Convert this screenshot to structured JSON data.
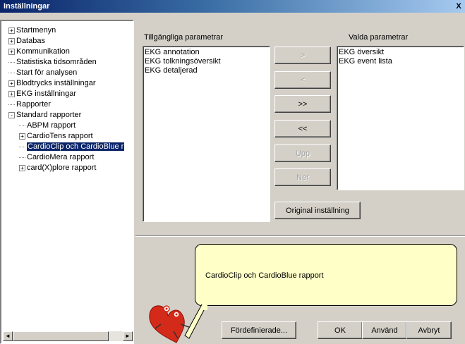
{
  "window": {
    "title": "Inställningar",
    "close_glyph": "X"
  },
  "tree": {
    "items": [
      {
        "label": "Startmenyn",
        "expander": "+"
      },
      {
        "label": "Databas",
        "expander": "+"
      },
      {
        "label": "Kommunikation",
        "expander": "+"
      },
      {
        "label": "Statistiska tidsområden",
        "expander": ""
      },
      {
        "label": "Start för analysen",
        "expander": ""
      },
      {
        "label": "Blodtrycks inställningar",
        "expander": "+"
      },
      {
        "label": "EKG inställningar",
        "expander": "+"
      },
      {
        "label": "Rapporter",
        "expander": ""
      },
      {
        "label": "Standard rapporter",
        "expander": "-"
      },
      {
        "label": "ABPM rapport",
        "expander": ""
      },
      {
        "label": "CardioTens rapport",
        "expander": "+"
      },
      {
        "label": "CardioClip och CardioBlue r",
        "expander": "",
        "selected": true
      },
      {
        "label": "CardioMera rapport",
        "expander": ""
      },
      {
        "label": "card(X)plore rapport",
        "expander": "+"
      }
    ],
    "scroll_left": "◄",
    "scroll_right": "►"
  },
  "params": {
    "available_label": "Tillgängliga parametrar",
    "selected_label": "Valda parametrar",
    "available": [
      "EKG annotation",
      "EKG tolkningsöversikt",
      "EKG detaljerad"
    ],
    "selected": [
      "EKG översikt",
      "EKG event lista"
    ]
  },
  "buttons": {
    "add": ">",
    "remove": "<",
    "add_all": ">>",
    "remove_all": "<<",
    "up": "Upp",
    "down": "Ner",
    "original": "Original inställning",
    "predefined": "Fördefinierade...",
    "ok": "OK",
    "apply": "Använd",
    "cancel": "Avbryt"
  },
  "help": {
    "text": "CardioClip och CardioBlue rapport"
  },
  "colors": {
    "selection": "#0a246a",
    "bubble": "#ffffc8",
    "mascot": "#d42a1a"
  }
}
